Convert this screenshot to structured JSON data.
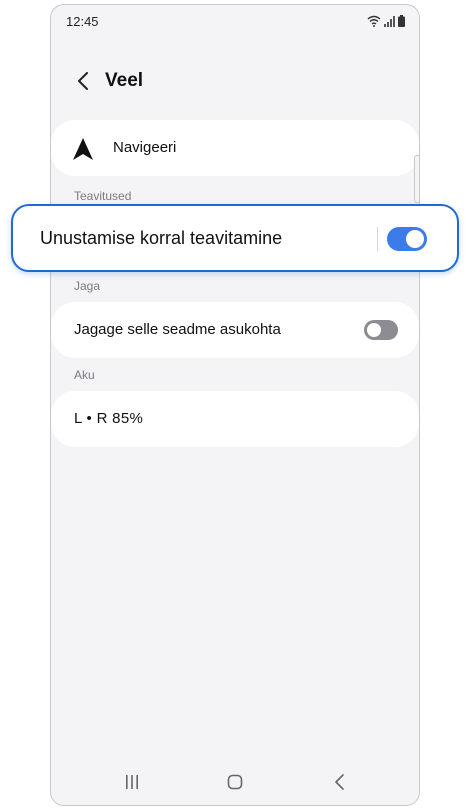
{
  "status_bar": {
    "time": "12:45"
  },
  "header": {
    "title": "Veel"
  },
  "navigate": {
    "label": "Navigeeri"
  },
  "notifications": {
    "section_title": "Teavitused",
    "forget_alert_label": "Unustamise korral teavitamine",
    "forget_alert_enabled": true
  },
  "share": {
    "section_title": "Jaga",
    "share_location_label": "Jagage selle seadme asukohta",
    "share_location_enabled": false
  },
  "battery": {
    "section_title": "Aku",
    "level_text": "L • R  85%"
  },
  "colors": {
    "accent": "#3e7bea",
    "highlight_border": "#1e6bd6",
    "toggle_off": "#8c8c92",
    "background": "#f4f4f6"
  },
  "icons": {
    "back": "chevron-left-icon",
    "navigate": "navigation-arrow-icon",
    "wifi": "wifi-icon",
    "signal": "signal-icon",
    "battery": "battery-icon",
    "recent_apps": "recent-apps-icon",
    "home": "home-icon",
    "nav_back": "back-icon"
  }
}
